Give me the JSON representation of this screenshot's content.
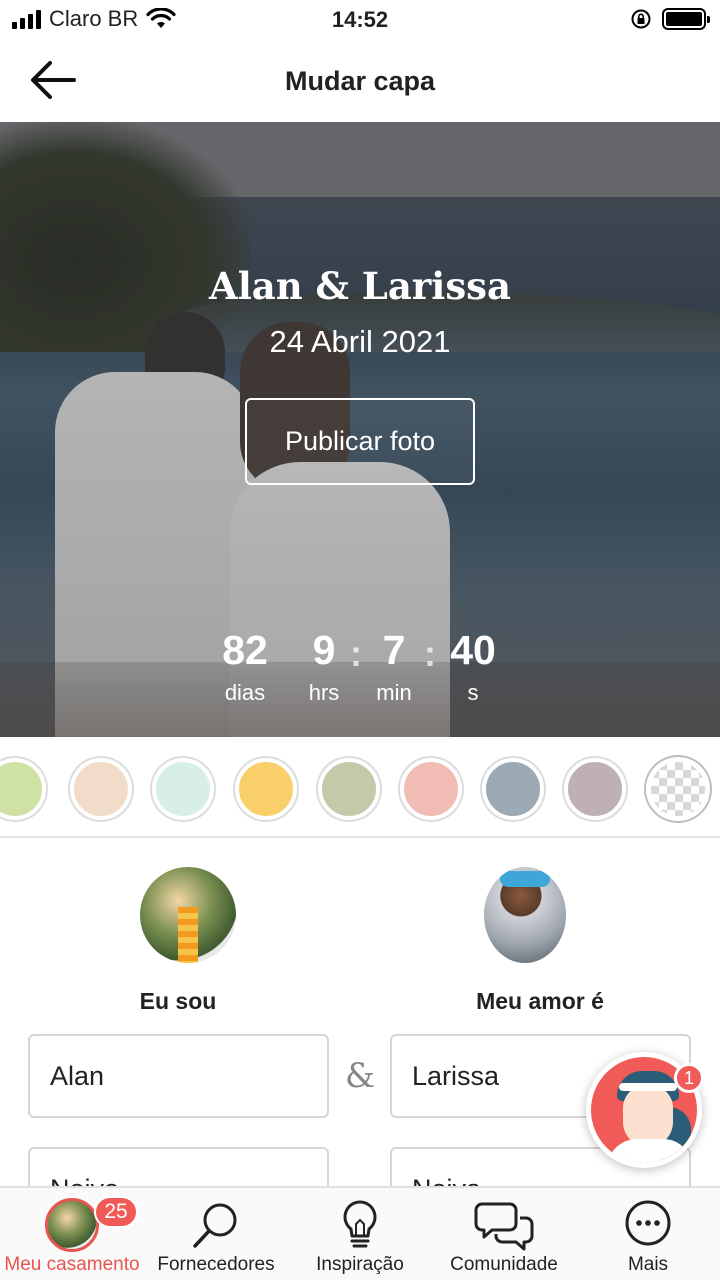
{
  "status_bar": {
    "carrier": "Claro BR",
    "time": "14:52"
  },
  "header": {
    "title": "Mudar capa"
  },
  "cover": {
    "couple_names": "Alan & Larissa",
    "date": "24 Abril 2021",
    "publish_button": "Publicar foto",
    "countdown": {
      "days": "82",
      "days_label": "dias",
      "hours": "9",
      "hours_label": "hrs",
      "minutes": "7",
      "minutes_label": "min",
      "seconds": "40",
      "seconds_label": "s"
    }
  },
  "colors": [
    "#cfe1a3",
    "#f0dcc9",
    "#d8efe9",
    "#f9cf6a",
    "#c4c9a9",
    "#f0bcb4",
    "#9caab5",
    "#bfb0b5",
    "checker"
  ],
  "profile": {
    "me_label": "Eu sou",
    "partner_label": "Meu amor é",
    "me_name": "Alan",
    "partner_name": "Larissa",
    "ampersand": "&",
    "me_role": "Noivo",
    "partner_role": "Noiva"
  },
  "chat": {
    "badge": "1"
  },
  "tabbar": {
    "items": [
      {
        "label": "Meu casamento",
        "icon": "avatar-icon",
        "badge": "25"
      },
      {
        "label": "Fornecedores",
        "icon": "search-icon"
      },
      {
        "label": "Inspiração",
        "icon": "lightbulb-icon"
      },
      {
        "label": "Comunidade",
        "icon": "chat-bubbles-icon"
      },
      {
        "label": "Mais",
        "icon": "more-icon"
      }
    ]
  }
}
